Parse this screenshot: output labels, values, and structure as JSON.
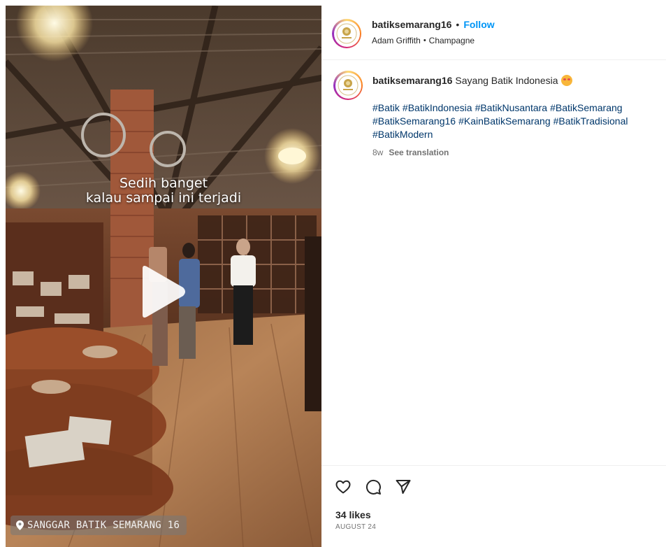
{
  "video": {
    "overlay_line1": "Sedih banget",
    "overlay_line2": "kalau sampai ini terjadi",
    "location_label": "SANGGAR BATIK SEMARANG 16",
    "location_icon": "location-pin-icon",
    "play_icon": "play-icon"
  },
  "header": {
    "username": "batiksemarang16",
    "separator": "•",
    "follow_label": "Follow",
    "audio_artist": "Adam Griffith",
    "audio_separator": "•",
    "audio_title": "Champagne"
  },
  "caption": {
    "username": "batiksemarang16",
    "text": "Sayang Batik Indonesia",
    "emoji": "smiling-face-with-hearts",
    "hashtags": [
      "#Batik",
      "#BatikIndonesia",
      "#BatikNusantara",
      "#BatikSemarang",
      "#BatikSemarang16",
      "#KainBatikSemarang",
      "#BatikTradisional",
      "#BatikModern"
    ],
    "age": "8w",
    "see_translation": "See translation"
  },
  "actions": {
    "like_icon": "heart-icon",
    "comment_icon": "comment-icon",
    "share_icon": "share-icon",
    "likes": "34 likes",
    "date": "AUGUST 24"
  },
  "colors": {
    "follow": "#0095f6",
    "hashtag": "#00376b",
    "muted": "#737373",
    "text": "#262626"
  }
}
